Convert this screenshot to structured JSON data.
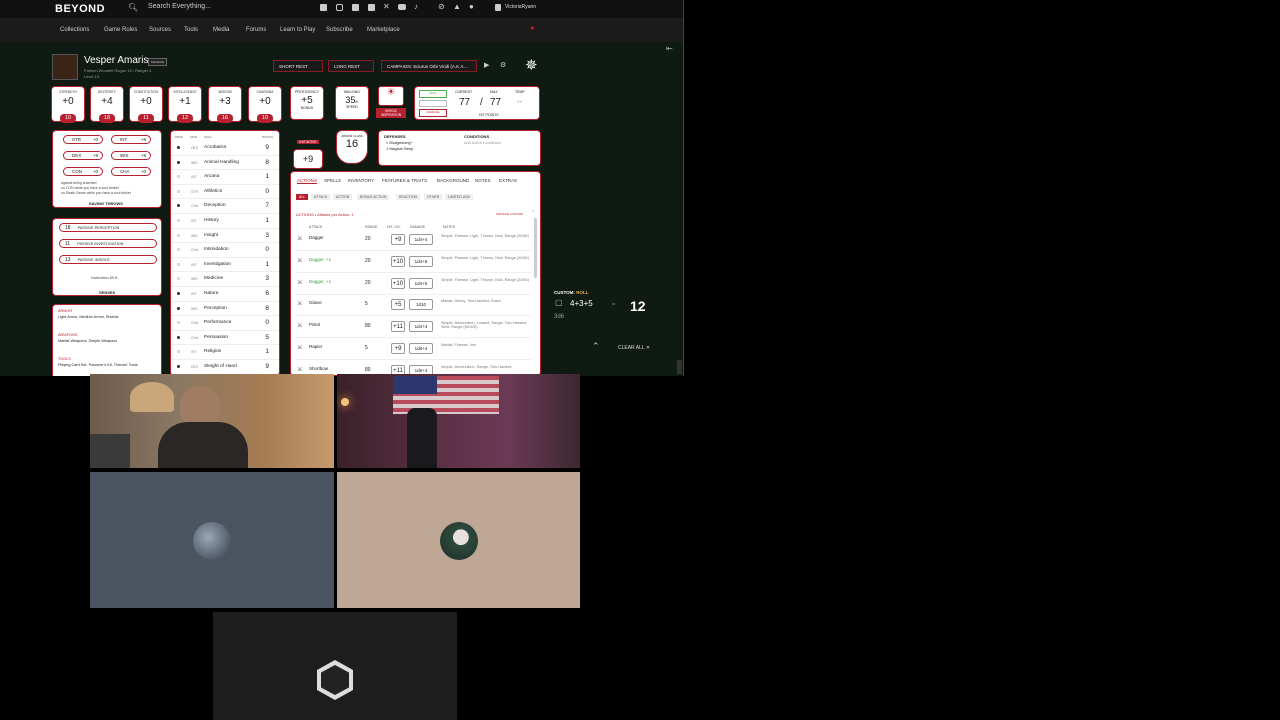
{
  "topbar": {
    "logo": "BEYOND",
    "search_placeholder": "Search Everything...",
    "username": "VictoriaRyann"
  },
  "nav": [
    "Collections",
    "Game Rules",
    "Sources",
    "Tools",
    "Media",
    "Forums",
    "Learn to Play",
    "Subscribe",
    "Marketplace"
  ],
  "character": {
    "name": "Vesper Amaris",
    "manage": "MANAGE",
    "subtitle": "Fathom Woodelf Rogue 15 / Ranger 4",
    "level": "Level 19",
    "short_rest": "SHORT REST",
    "long_rest": "LONG REST",
    "campaign": "CAMPAIGN: Sciurus Orbi Viridi (A.K.A..."
  },
  "abilities": [
    {
      "label": "STRENGTH",
      "mod": "+0",
      "score": "10"
    },
    {
      "label": "DEXTERITY",
      "mod": "+4",
      "score": "18"
    },
    {
      "label": "CONSTITUTION",
      "mod": "+0",
      "score": "11"
    },
    {
      "label": "INTELLIGENCE",
      "mod": "+1",
      "score": "12"
    },
    {
      "label": "WISDOM",
      "mod": "+3",
      "score": "16"
    },
    {
      "label": "CHARISMA",
      "mod": "+0",
      "score": "10"
    }
  ],
  "proficiency": {
    "label": "PROFICIENCY",
    "value": "+5",
    "sub": "BONUS"
  },
  "walking": {
    "label": "WALKING",
    "value": "35",
    "unit": "ft.",
    "sub": "SPEED"
  },
  "inspiration": "HEROIC INSPIRATION",
  "hp": {
    "heal": "HEAL",
    "damage": "DAMAGE",
    "current_label": "CURRENT",
    "max_label": "MAX",
    "temp_label": "TEMP",
    "current": "77",
    "max": "77",
    "temp": "--",
    "title": "HIT POINTS"
  },
  "initiative": {
    "label": "INITIATIVE",
    "value": "+9"
  },
  "armor": {
    "label": "ARMOR CLASS",
    "value": "16"
  },
  "defenses": {
    "title": "DEFENSES",
    "items": [
      "Bludgeoning*",
      "Magical Sleep"
    ]
  },
  "conditions": {
    "title": "CONDITIONS",
    "placeholder": "Add Active Conditions"
  },
  "saves": {
    "rows": [
      [
        "STR",
        "+0",
        "INT",
        "+6"
      ],
      [
        "DEX",
        "+9",
        "WIS",
        "+8"
      ],
      [
        "CON",
        "+0",
        "CHA",
        "+0"
      ]
    ],
    "notes": [
      "against being charmed",
      "on CON while you have a soul trinket",
      "on Death Saves while you have a soul trinket"
    ],
    "title": "SAVING THROWS"
  },
  "senses": {
    "rows": [
      [
        "18",
        "PASSIVE PERCEPTION"
      ],
      [
        "11",
        "PASSIVE INVESTIGATION"
      ],
      [
        "13",
        "PASSIVE INSIGHT"
      ]
    ],
    "darkvision": "Darkvision 60 ft.",
    "title": "SENSES"
  },
  "proficiencies": [
    {
      "title": "ARMOR",
      "text": "Light Armor, Medium Armor, Shields"
    },
    {
      "title": "WEAPONS",
      "text": "Martial Weapons, Simple Weapons"
    },
    {
      "title": "TOOLS",
      "text": "Playing Card Set, Poisoner's Kit, Thieves' Tools"
    }
  ],
  "skills_header": [
    "PROF",
    "MOD",
    "SKILL",
    "BONUS"
  ],
  "skills": [
    {
      "ab": "DEX",
      "name": "Acrobatics",
      "bonus": "9",
      "prof": true
    },
    {
      "ab": "WIS",
      "name": "Animal Handling",
      "bonus": "8",
      "prof": true
    },
    {
      "ab": "INT",
      "name": "Arcana",
      "bonus": "1",
      "prof": false
    },
    {
      "ab": "STR",
      "name": "Athletics",
      "bonus": "0",
      "prof": false
    },
    {
      "ab": "CHA",
      "name": "Deception",
      "bonus": "7",
      "prof": true
    },
    {
      "ab": "INT",
      "name": "History",
      "bonus": "1",
      "prof": false
    },
    {
      "ab": "WIS",
      "name": "Insight",
      "bonus": "3",
      "prof": false
    },
    {
      "ab": "CHA",
      "name": "Intimidation",
      "bonus": "0",
      "prof": false
    },
    {
      "ab": "INT",
      "name": "Investigation",
      "bonus": "1",
      "prof": false
    },
    {
      "ab": "WIS",
      "name": "Medicine",
      "bonus": "3",
      "prof": false
    },
    {
      "ab": "INT",
      "name": "Nature",
      "bonus": "6",
      "prof": true
    },
    {
      "ab": "WIS",
      "name": "Perception",
      "bonus": "8",
      "prof": true
    },
    {
      "ab": "CHA",
      "name": "Performance",
      "bonus": "0",
      "prof": false
    },
    {
      "ab": "CHA",
      "name": "Persuasion",
      "bonus": "5",
      "prof": true
    },
    {
      "ab": "INT",
      "name": "Religion",
      "bonus": "1",
      "prof": false
    },
    {
      "ab": "DEX",
      "name": "Sleight of Hand",
      "bonus": "9",
      "prof": true
    }
  ],
  "action_tabs": [
    "ACTIONS",
    "SPELLS",
    "INVENTORY",
    "FEATURES & TRAITS",
    "BACKGROUND",
    "NOTES",
    "EXTRAS"
  ],
  "action_filters": [
    "ALL",
    "ATTACK",
    "ACTION",
    "BONUS ACTION",
    "REACTION",
    "OTHER",
    "LIMITED USE"
  ],
  "actions_heading": "ACTIONS • Attacks per Action: 1",
  "manage_custom": "MANAGE CUSTOM",
  "attack_headers": [
    "ATTACK",
    "RANGE",
    "HIT / DC",
    "DAMAGE",
    "NOTES"
  ],
  "attacks": [
    {
      "name": "Dagger",
      "range": "20",
      "hit": "+9",
      "dmg": "1d4+4",
      "notes": "Simple, Finesse, Light, Thrown, Nick, Range (20/60)"
    },
    {
      "name": "Dagger, +1",
      "range": "20",
      "hit": "+10",
      "dmg": "1d4+5",
      "notes": "Simple, Finesse, Light, Thrown, Nick, Range (20/60)"
    },
    {
      "name": "Dagger, +1",
      "range": "20",
      "hit": "+10",
      "dmg": "1d4+5",
      "notes": "Simple, Finesse, Light, Thrown, Nick, Range (20/60)"
    },
    {
      "name": "Glaive",
      "range": "5",
      "hit": "+5",
      "dmg": "1d10",
      "notes": "Martial, Heavy, Two-Handed, Graze"
    },
    {
      "name": "Pistol",
      "range": "80",
      "hit": "+11",
      "dmg": "1d4+4",
      "notes": "Simple, Ammunition, Loaded, Range, Two-Handed, Slow, Range (80/320)"
    },
    {
      "name": "Rapier",
      "range": "5",
      "hit": "+9",
      "dmg": "1d8+4",
      "notes": "Martial, Finesse, Vex"
    },
    {
      "name": "Shortbow",
      "range": "80",
      "hit": "+11",
      "dmg": "1d6+4",
      "notes": "Simple, Ammunition, Range, Two-Handed"
    }
  ],
  "roll": {
    "label": "CUSTOM:",
    "type": "ROLL",
    "expr": "4+3+5",
    "dice": "3d6",
    "result": "12",
    "clear": "CLEAR ALL"
  },
  "cams": [
    {
      "name": "cam-1"
    },
    {
      "name": "cam-2"
    }
  ],
  "colors": {
    "accent": "#b7202f",
    "sheet_bg": "#0e1a12",
    "cam3": "#4a5561",
    "cam4": "#bfa796"
  }
}
